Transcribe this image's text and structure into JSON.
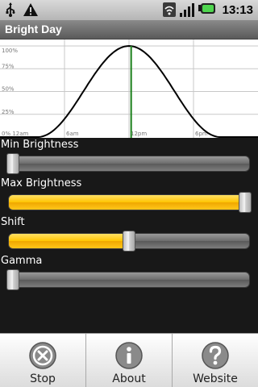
{
  "statusbar": {
    "time": "13:13",
    "icons": [
      "usb-icon",
      "warning-icon",
      "wifi-icon",
      "signal-icon",
      "battery-icon"
    ]
  },
  "app": {
    "title": "Bright Day"
  },
  "chart_data": {
    "type": "line",
    "x_labels": [
      "0% 12am",
      "6am",
      "12pm",
      "6pm"
    ],
    "y_labels": [
      "100%",
      "75%",
      "50%",
      "25%"
    ],
    "x_range_hours": [
      0,
      24
    ],
    "y_range_percent": [
      0,
      100
    ],
    "series": [
      {
        "color": "#000000",
        "x": [
          0,
          3,
          6,
          9,
          12,
          15,
          18,
          21,
          24
        ],
        "y": [
          0,
          0,
          10,
          60,
          100,
          72,
          28,
          5,
          0
        ]
      }
    ],
    "marker": {
      "x_hour": 12.2,
      "color": "#1a7f1a"
    },
    "grid": true
  },
  "controls": {
    "min_brightness": {
      "label": "Min Brightness",
      "value": 0.02
    },
    "max_brightness": {
      "label": "Max Brightness",
      "value": 0.98
    },
    "shift": {
      "label": "Shift",
      "value": 0.5
    },
    "gamma": {
      "label": "Gamma",
      "value": 0.02
    },
    "accent": "#ffc400"
  },
  "menu": {
    "items": [
      {
        "label": "Stop",
        "icon": "stop-icon"
      },
      {
        "label": "About",
        "icon": "info-icon"
      },
      {
        "label": "Website",
        "icon": "help-icon"
      }
    ]
  }
}
